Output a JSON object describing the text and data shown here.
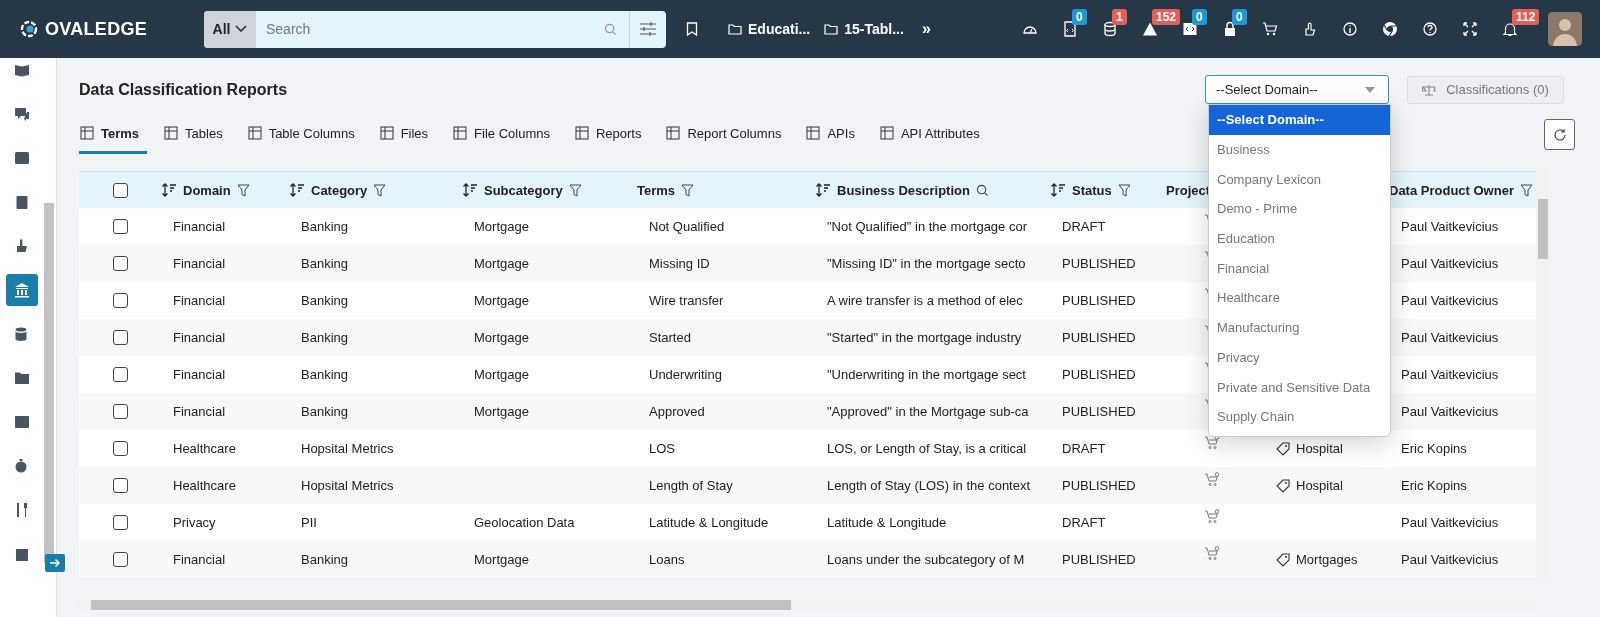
{
  "topbar": {
    "logo": "OVALEDGE",
    "search": {
      "scope": "All",
      "placeholder": "Search"
    },
    "breadcrumbs": [
      "Educati...",
      "15-Tabl..."
    ],
    "more": "»",
    "badges": [
      {
        "count": "0",
        "color": "#1a9bd7"
      },
      {
        "count": "1",
        "color": "#e0605a"
      },
      {
        "count": "152",
        "color": "#e0605a"
      },
      {
        "count": "0",
        "color": "#1a9bd7"
      },
      {
        "count": "0",
        "color": "#1a9bd7"
      },
      {
        "count": "112",
        "color": "#e0605a"
      }
    ]
  },
  "sidebar": {
    "items": [
      {
        "selected": false
      },
      {
        "selected": false
      },
      {
        "selected": false
      },
      {
        "selected": false
      },
      {
        "selected": false
      },
      {
        "selected": true
      },
      {
        "selected": false
      },
      {
        "selected": false
      },
      {
        "selected": false
      },
      {
        "selected": false
      },
      {
        "selected": false
      },
      {
        "selected": false
      }
    ]
  },
  "page": {
    "title": "Data Classification Reports",
    "domain_select": {
      "value": "--Select Domain--",
      "expanded": true,
      "options": [
        {
          "label": "--Select Domain--",
          "selected": true
        },
        {
          "label": "Business",
          "selected": false
        },
        {
          "label": "Company Lexicon",
          "selected": false
        },
        {
          "label": "Demo - Prime",
          "selected": false
        },
        {
          "label": "Education",
          "selected": false
        },
        {
          "label": "Financial",
          "selected": false
        },
        {
          "label": "Healthcare",
          "selected": false
        },
        {
          "label": "Manufacturing",
          "selected": false
        },
        {
          "label": "Privacy",
          "selected": false
        },
        {
          "label": "Private and Sensitive Data",
          "selected": false
        },
        {
          "label": "Supply Chain",
          "selected": false
        }
      ]
    },
    "classifications_button": "Classifications (0)",
    "tabs": [
      {
        "label": "Terms",
        "selected": true
      },
      {
        "label": "Tables",
        "selected": false
      },
      {
        "label": "Table Columns",
        "selected": false
      },
      {
        "label": "Files",
        "selected": false
      },
      {
        "label": "File Columns",
        "selected": false
      },
      {
        "label": "Reports",
        "selected": false
      },
      {
        "label": "Report Columns",
        "selected": false
      },
      {
        "label": "APIs",
        "selected": false
      },
      {
        "label": "API Attributes",
        "selected": false
      }
    ]
  },
  "table": {
    "columns": [
      {
        "label": "Domain",
        "sortable": true,
        "filter": true,
        "search": false
      },
      {
        "label": "Category",
        "sortable": true,
        "filter": true,
        "search": false
      },
      {
        "label": "Subcategory",
        "sortable": true,
        "filter": true,
        "search": false
      },
      {
        "label": "Terms",
        "sortable": false,
        "filter": true,
        "search": false
      },
      {
        "label": "Business Description",
        "sortable": true,
        "filter": false,
        "search": true
      },
      {
        "label": "Status",
        "sortable": true,
        "filter": true,
        "search": false
      },
      {
        "label": "Project",
        "sortable": false,
        "filter": false,
        "search": false
      },
      {
        "label": "Data Product Owner",
        "sortable": false,
        "filter": true,
        "search": false
      }
    ],
    "all_checked": false,
    "rows": [
      {
        "checked": false,
        "domain": "Financial",
        "category": "Banking",
        "subcategory": "Mortgage",
        "term": "Not Qualified",
        "description": "\"Not Qualified\" in the mortgage cor",
        "status": "DRAFT",
        "owner": "Paul Vaitkevicius"
      },
      {
        "checked": false,
        "domain": "Financial",
        "category": "Banking",
        "subcategory": "Mortgage",
        "term": "Missing ID",
        "description": "\"Missing ID\" in the mortgage secto",
        "status": "PUBLISHED",
        "owner": "Paul Vaitkevicius"
      },
      {
        "checked": false,
        "domain": "Financial",
        "category": "Banking",
        "subcategory": "Mortgage",
        "term": "Wire transfer",
        "description": "A wire transfer is a method of elec",
        "status": "PUBLISHED",
        "owner": "Paul Vaitkevicius"
      },
      {
        "checked": false,
        "domain": "Financial",
        "category": "Banking",
        "subcategory": "Mortgage",
        "term": "Started",
        "description": "\"Started\" in the mortgage industry",
        "status": "PUBLISHED",
        "owner": "Paul Vaitkevicius"
      },
      {
        "checked": false,
        "domain": "Financial",
        "category": "Banking",
        "subcategory": "Mortgage",
        "term": "Underwriting",
        "description": "\"Underwriting in the mortgage sect",
        "status": "PUBLISHED",
        "owner": "Paul Vaitkevicius"
      },
      {
        "checked": false,
        "domain": "Financial",
        "category": "Banking",
        "subcategory": "Mortgage",
        "term": "Approved",
        "description": "\"Approved\" in the Mortgage sub-ca",
        "status": "PUBLISHED",
        "owner": "Paul Vaitkevicius"
      },
      {
        "checked": false,
        "domain": "Healthcare",
        "category": "Hopsital Metrics",
        "term": "LOS",
        "description": "LOS, or Length of Stay, is a critical",
        "status": "DRAFT",
        "tag": "Hospital",
        "owner": "Eric Kopins"
      },
      {
        "checked": false,
        "domain": "Healthcare",
        "category": "Hopsital Metrics",
        "term": "Length of Stay",
        "description": "Length of Stay (LOS) in the context",
        "status": "PUBLISHED",
        "tag": "Hospital",
        "owner": "Eric Kopins"
      },
      {
        "checked": false,
        "domain": "Privacy",
        "category": "PII",
        "subcategory": "Geolocation Data",
        "term": "Latitude & Longitude",
        "description": "Latitude & Longitude",
        "status": "DRAFT",
        "owner": "Paul Vaitkevicius"
      },
      {
        "checked": false,
        "domain": "Financial",
        "category": "Banking",
        "subcategory": "Mortgage",
        "term": "Loans",
        "description": "Loans under the subcategory of M",
        "status": "PUBLISHED",
        "tag": "Mortgages",
        "owner": "Paul Vaitkevicius"
      }
    ]
  }
}
